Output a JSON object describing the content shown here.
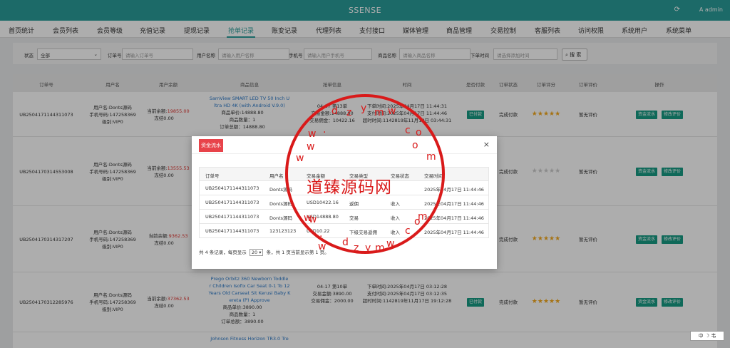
{
  "topbar": {
    "title": "SSENSE",
    "refresh_icon": "refresh-icon",
    "user": "A admin"
  },
  "nav": [
    "首页统计",
    "会员列表",
    "会员等级",
    "充值记录",
    "提现记录",
    "抢单记录",
    "账变记录",
    "代理列表",
    "支付接口",
    "媒体管理",
    "商品管理",
    "交易控制",
    "客服列表",
    "访问权限",
    "系统用户",
    "系统菜单"
  ],
  "nav_active": "抢单记录",
  "filter": {
    "status_label": "状态",
    "status_value": "全部",
    "order_label": "订单号",
    "order_placeholder": "请输入订单号",
    "username_label": "用户名称",
    "username_placeholder": "请输入用户名称",
    "phone_label": "手机号",
    "phone_placeholder": "请输入用户手机号",
    "product_label": "商品名称",
    "product_placeholder": "请输入商品名称",
    "time_label": "下单时间",
    "time_placeholder": "请选择添加时间",
    "search_label": "搜 索"
  },
  "table": {
    "headers": [
      "订单号",
      "用户名",
      "用户余额",
      "商品信息",
      "抢单信息",
      "时间",
      "是否付款",
      "订单状态",
      "订单评分",
      "订单评价",
      "操作"
    ],
    "rows": [
      {
        "order": "UB2504171144311073",
        "user": [
          "用户名:Donts源码",
          "手机号码:147258369",
          "级别:VIP0"
        ],
        "balance_label": "当前余额:",
        "balance": "19855.00",
        "frozen": "冻结0.00",
        "product": [
          "SamView SMART LED TV 50 Inch U",
          "ltra HD 4K (with Android V.9.0)"
        ],
        "product_detail": [
          "商品单价:14888.80",
          "商品数量：1",
          "订单总额：14888.80"
        ],
        "grab": [
          "04-17 第13单",
          "交易金额:14888.80",
          "交易佣金：10422.16"
        ],
        "time": [
          "下单时间:2025年04月17日 11:44:31",
          "支付时间:2025年04月17日 11:44:46",
          "超时时间:1142819年11月18日 03:44:31"
        ],
        "paid": "已付款",
        "status": "完成付款",
        "stars": 5,
        "review": "暂无评价",
        "btn1": "资金流水",
        "btn2": "修改评价"
      },
      {
        "order": "UB2504170314553008",
        "user": [
          "用户名:Donts源码",
          "手机号码:147258369",
          "级别:VIP0"
        ],
        "balance_label": "当前余额:",
        "balance": "13555.53",
        "frozen": "冻结0.00",
        "stars": 0,
        "status": "完成付款",
        "review": "暂无评价",
        "btn1": "资金流水",
        "btn2": "修改评价"
      },
      {
        "order": "UB2504170314317207",
        "user": [
          "用户名:Donts源码",
          "手机号码:147258369",
          "级别:VIP0"
        ],
        "balance_label": "当前余额:",
        "balance": "9362.53",
        "frozen": "冻结0.00",
        "stars": 5,
        "status": "完成付款",
        "review": "暂无评价",
        "btn1": "资金流水",
        "btn2": "修改评价"
      },
      {
        "order": "UB2504170312285976",
        "user": [
          "用户名:Donts源码",
          "手机号码:147258369",
          "级别:VIP0"
        ],
        "balance_label": "当前余额:",
        "balance": "37362.53",
        "frozen": "冻结0.00",
        "product": [
          "Prego Orbitz 360 Newborn Toddle",
          "r Children Isofix Car Seat 0-1 To 12",
          "Years Old Carseat Sit Kerusi Baby K",
          "ereta (P) Approve"
        ],
        "product_detail": [
          "商品单价:3890.00",
          "商品数量：1",
          "订单总额：3890.00"
        ],
        "grab": [
          "04-17 第10单",
          "交易金额:3890.00",
          "交易佣金：2000.00"
        ],
        "time": [
          "下单时间:2025年04月17日 03:12:28",
          "支付时间:2025年04月17日 03:12:35",
          "超时时间:1142819年11月17日 19:12:28"
        ],
        "paid": "已付款",
        "status": "完成付款",
        "stars": 5,
        "review": "暂无评价",
        "btn1": "资金流水",
        "btn2": "修改评价"
      },
      {
        "product": [
          "Johnson Fitness Horizon TR3.0 Tre"
        ]
      }
    ]
  },
  "modal": {
    "title": "资金流水",
    "close": "×",
    "headers": [
      "订单号",
      "用户名",
      "交易金额",
      "交易类型",
      "交易状态",
      "交易时间"
    ],
    "rows": [
      [
        "UB2504171144311073",
        "Donts源码",
        "",
        "",
        "",
        "2025年04月17日 11:44:46"
      ],
      [
        "UB2504171144311073",
        "Donts源码",
        "USD10422.16",
        "返佣",
        "收入",
        "2025年04月17日 11:44:46"
      ],
      [
        "UB2504171144311073",
        "Donts源码",
        "USD14888.80",
        "交易",
        "收入",
        "2025年04月17日 11:44:46"
      ],
      [
        "UB2504171144311073",
        "123123123",
        "USD10.22",
        "下级交易返佣",
        "收入",
        "2025年04月17日 11:44:46"
      ]
    ],
    "footer_a": "共 4 条记录，每页显示",
    "page_size": "20",
    "footer_b": "条，共 1 页当前显示第 1 页。"
  },
  "watermark": {
    "text": "道臻源码网",
    "chars": [
      "d",
      "z",
      "y",
      "m",
      "w",
      ".",
      "c",
      "o",
      "m",
      "w",
      "w",
      ".",
      "w",
      "w",
      "w",
      "c",
      "o",
      "m",
      "d",
      "z",
      "y",
      "m",
      "w"
    ]
  },
  "corner": "中 ☽ 韦"
}
